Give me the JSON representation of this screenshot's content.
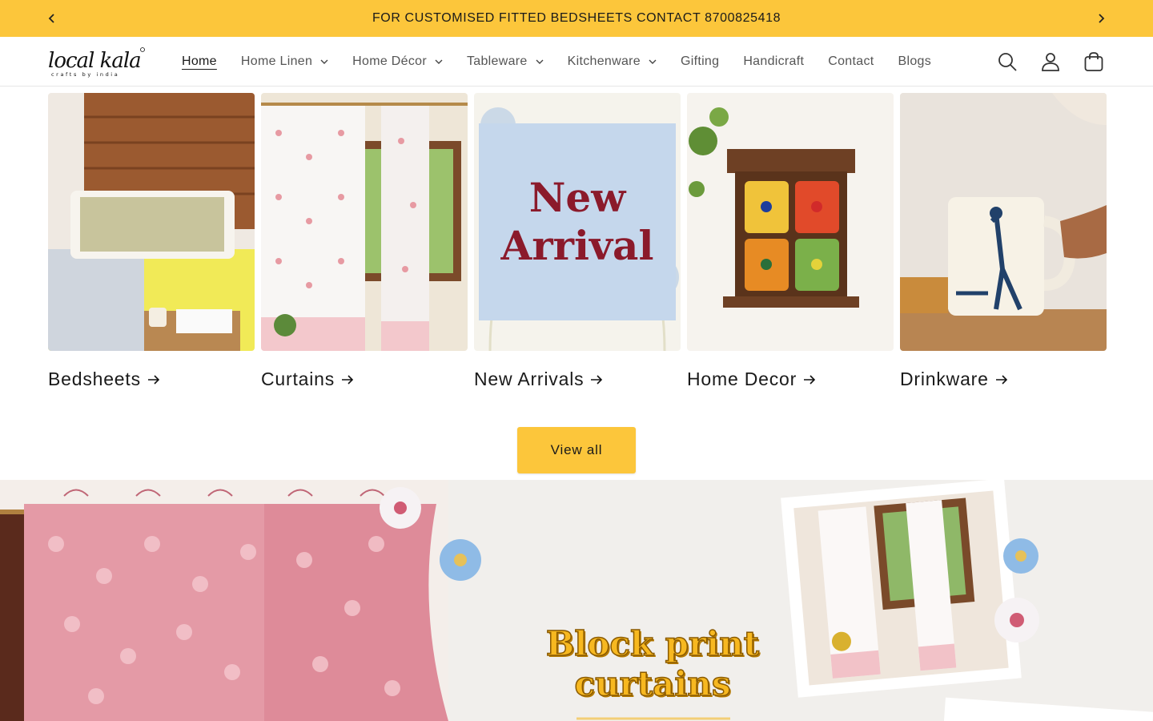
{
  "announcement": {
    "text": "FOR CUSTOMISED FITTED BEDSHEETS CONTACT 8700825418",
    "prev_icon": "chevron-left-icon",
    "next_icon": "chevron-right-icon"
  },
  "header": {
    "logo": {
      "name": "local kala",
      "tagline": "crafts by india"
    },
    "nav": [
      {
        "label": "Home",
        "active": true,
        "dropdown": false
      },
      {
        "label": "Home Linen",
        "active": false,
        "dropdown": true
      },
      {
        "label": "Home Décor",
        "active": false,
        "dropdown": true
      },
      {
        "label": "Tableware",
        "active": false,
        "dropdown": true
      },
      {
        "label": "Kitchenware",
        "active": false,
        "dropdown": true
      },
      {
        "label": "Gifting",
        "active": false,
        "dropdown": false
      },
      {
        "label": "Handicraft",
        "active": false,
        "dropdown": false
      },
      {
        "label": "Contact",
        "active": false,
        "dropdown": false
      },
      {
        "label": "Blogs",
        "active": false,
        "dropdown": false
      }
    ],
    "icons": [
      "search-icon",
      "account-icon",
      "cart-icon"
    ]
  },
  "collections": [
    {
      "title": "Bedsheets"
    },
    {
      "title": "Curtains"
    },
    {
      "title": "New Arrivals",
      "image_text": [
        "New",
        "Arrival"
      ]
    },
    {
      "title": "Home Decor"
    },
    {
      "title": "Drinkware"
    }
  ],
  "view_all_label": "View all",
  "banner": {
    "title_line1": "Block print",
    "title_line2": "curtains"
  },
  "colors": {
    "accent": "#fcc63b",
    "text": "#1a1a1a",
    "nav_text": "#555555",
    "new_arrival_text": "#8b1a2b"
  }
}
